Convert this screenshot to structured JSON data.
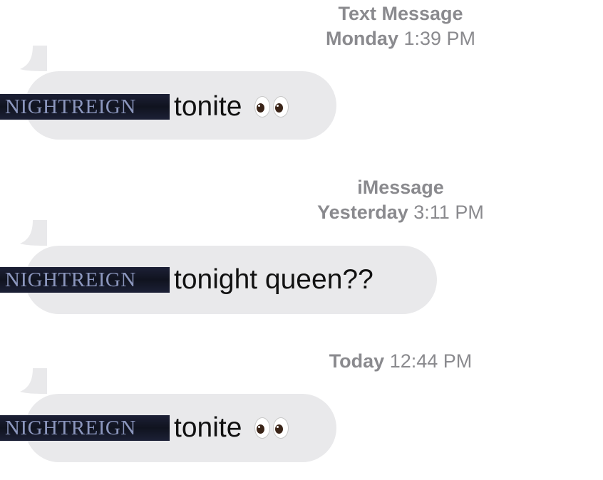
{
  "timestamps": [
    {
      "line1": "Text Message",
      "day": "Monday",
      "time": "1:39 PM"
    },
    {
      "line1": "iMessage",
      "day": "Yesterday",
      "time": "3:11 PM"
    },
    {
      "line1": "",
      "day": "Today",
      "time": "12:44 PM"
    }
  ],
  "messages": [
    {
      "logo": "NIGHTREIGN",
      "text": "tonite",
      "emoji": "eyes-emoji"
    },
    {
      "logo": "NIGHTREIGN",
      "text": "tonight queen??",
      "emoji": ""
    },
    {
      "logo": "NIGHTREIGN",
      "text": "tonite",
      "emoji": "eyes-emoji"
    }
  ],
  "colors": {
    "bubble": "#e9e9eb",
    "timestamp": "#8a8a8e",
    "text": "#111111",
    "logo_bg": "#10131f",
    "logo_text": "#8b96bd"
  }
}
